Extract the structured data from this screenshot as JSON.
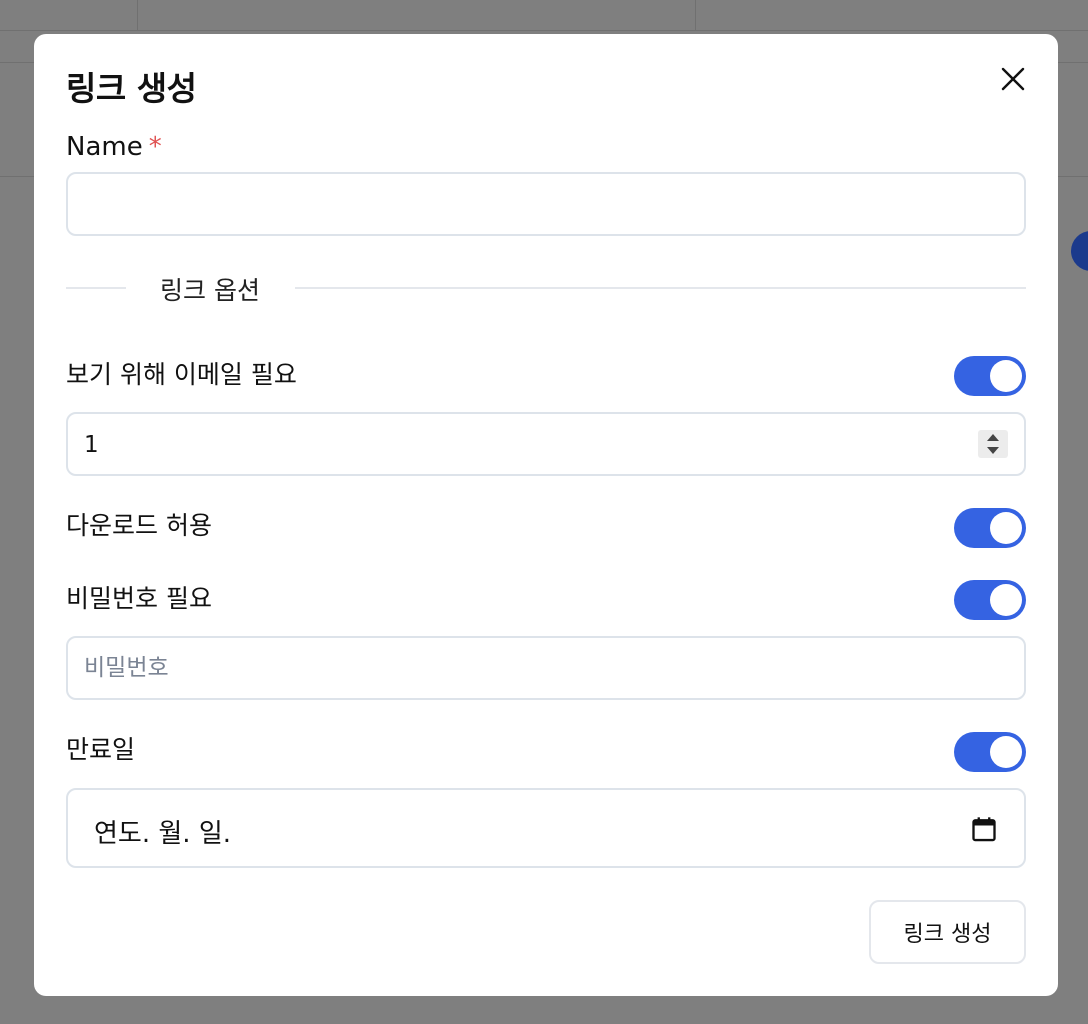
{
  "modal": {
    "title": "링크 생성",
    "name_label": "Name",
    "required_mark": "*",
    "name_value": "",
    "name_placeholder": "",
    "section_title": "링크 옵션",
    "options": {
      "require_email": {
        "label": "보기 위해 이메일 필요",
        "enabled": true
      },
      "allow_download": {
        "label": "다운로드 허용",
        "enabled": true
      },
      "require_password": {
        "label": "비밀번호 필요",
        "enabled": true
      },
      "expiration": {
        "label": "만료일",
        "enabled": true
      }
    },
    "number_value": "1",
    "password_placeholder": "비밀번호",
    "date_placeholder": "연도. 월. 일.",
    "submit_label": "링크 생성"
  },
  "colors": {
    "toggle_on": "#3563e2",
    "required": "#e05252",
    "overlay": "#7f7f7f"
  },
  "icons": {
    "close": "close-icon",
    "spinner": "spinner-arrows-icon",
    "calendar": "calendar-icon"
  }
}
